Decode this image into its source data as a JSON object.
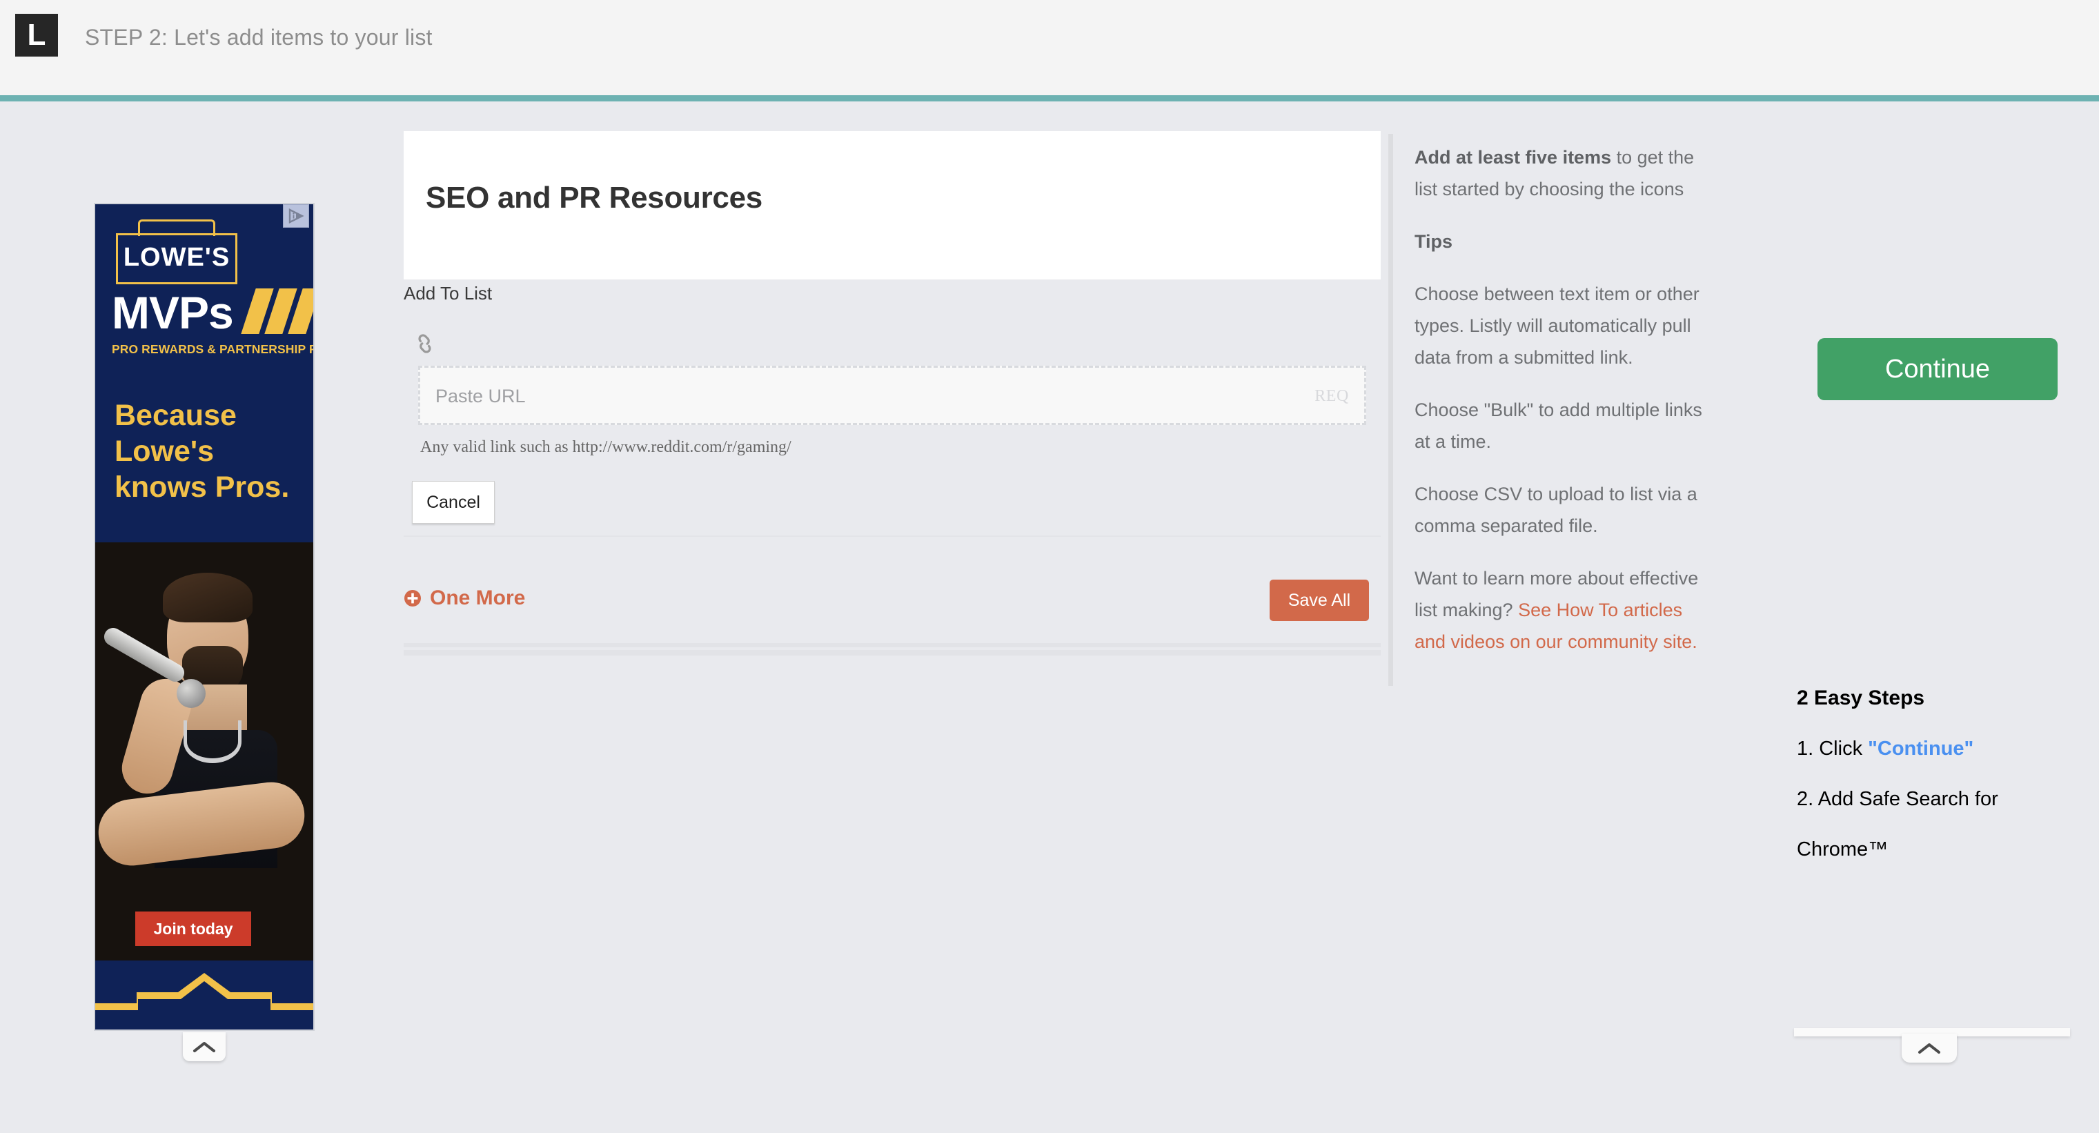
{
  "header": {
    "logo_letter": "L",
    "step_title": "STEP 2: Let's add items to your list",
    "accent_color": "#6db2b2"
  },
  "ad": {
    "adchoices_icon": "adchoices-icon",
    "brand": "LOWE'S",
    "program": "MVPs",
    "subtitle": "PRO REWARDS & PARTNERSHIP PROGRAM",
    "headline": "Because Lowe's knows Pros.",
    "cta_label": "Join today",
    "cta_color": "#cc3b2a",
    "background_color": "#0f2257",
    "accent_color": "#f2c149",
    "collapse_icon": "chevron-up-icon"
  },
  "main": {
    "list_title": "SEO and PR Resources",
    "add_to_list_label": "Add To List",
    "link_icon": "link-icon",
    "url_placeholder": "Paste URL",
    "url_value": "",
    "required_badge": "REQ",
    "url_help": "Any valid link such as http://www.reddit.com/r/gaming/",
    "cancel_label": "Cancel",
    "one_more_label": "One More",
    "one_more_icon": "plus-circle-icon",
    "one_more_color": "#d2694a",
    "save_all_label": "Save All",
    "save_all_color": "#d2694a"
  },
  "tips": {
    "intro_strong": "Add at least five items",
    "intro_rest": " to get the list started by choosing the icons",
    "heading": "Tips",
    "items": [
      "Choose between text item or other types. Listly will automatically pull data from a submitted link.",
      "Choose \"Bulk\" to add multiple links at a time.",
      "Choose CSV to upload to list via a comma separated file."
    ],
    "learn_more_prefix": "Want to learn more about effective list making? ",
    "learn_more_link": "See How To articles and videos on our community site.",
    "link_color": "#d2694a"
  },
  "right": {
    "continue_label": "Continue",
    "continue_color": "#41a166",
    "easy_steps_title": "2 Easy Steps",
    "step1_prefix": "1. Click ",
    "step1_link": "\"Continue\"",
    "step1_link_color": "#4a90f0",
    "step2": "2. Add Safe Search for",
    "step2_cont": "Chrome™",
    "collapse_icon": "chevron-up-icon"
  }
}
